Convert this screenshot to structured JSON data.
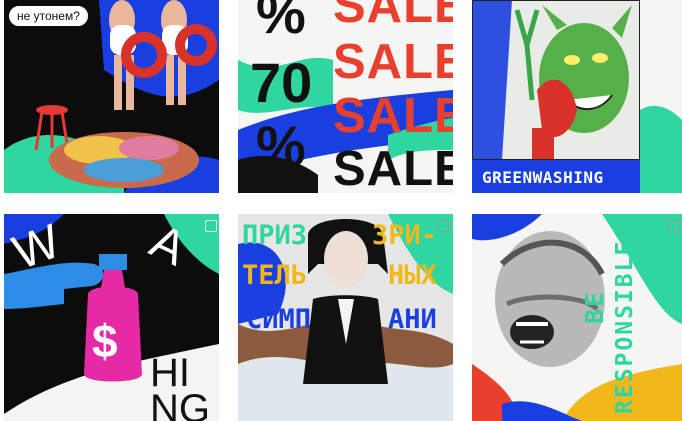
{
  "gallery": {
    "tiles": [
      {
        "name": "drowning-tile",
        "text": "не утонем?"
      },
      {
        "name": "sale-tile",
        "lines": [
          "%",
          "70",
          "%"
        ],
        "sale_word": "SALE"
      },
      {
        "name": "greenwashing-tile",
        "caption": "GREENWASHING"
      },
      {
        "name": "washing-tile",
        "letters": [
          "W",
          "A"
        ],
        "tail": [
          "HI",
          "NG"
        ]
      },
      {
        "name": "russian-tile",
        "words_left": [
          "ПРИЗ",
          "ТЕЛЬ",
          "СИМП"
        ],
        "words_right": [
          "ЗРИ-",
          "НЫХ",
          "АНИ"
        ]
      },
      {
        "name": "responsible-tile",
        "word_be": "BE",
        "word_responsible": "RESPONSIBLE"
      }
    ]
  },
  "colors": {
    "accent_blue": "#1a3fe0",
    "accent_green": "#2fd6a0",
    "sale_red": "#e8402d",
    "magenta": "#e62aa6",
    "yellow": "#f2b81a"
  },
  "icons": [
    "multiple-posts-icon",
    "dollar-icon"
  ]
}
